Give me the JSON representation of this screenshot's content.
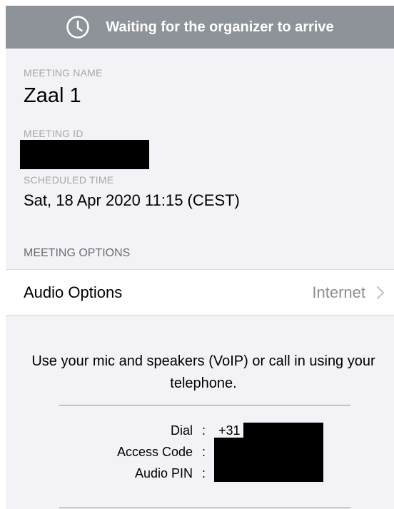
{
  "banner": {
    "icon": "clock-icon",
    "text": "Waiting for the organizer to arrive",
    "bg_color": "#8e9399"
  },
  "meeting": {
    "name_label": "MEETING NAME",
    "name": "Zaal 1",
    "id_label": "MEETING ID",
    "id_value": "",
    "time_label": "SCHEDULED TIME",
    "time": "Sat, 18 Apr 2020 11:15 (CEST)"
  },
  "options": {
    "header": "MEETING OPTIONS",
    "audio_label": "Audio Options",
    "audio_value": "Internet",
    "chevron_icon": "chevron-right-icon"
  },
  "audio_info": {
    "description": "Use your mic and speakers (VoIP) or call in using your telephone.",
    "dial_label": "Dial",
    "dial_value": "+31",
    "access_code_label": "Access Code",
    "access_code_value": "",
    "audio_pin_label": "Audio PIN",
    "audio_pin_value": "",
    "separator": ":"
  }
}
